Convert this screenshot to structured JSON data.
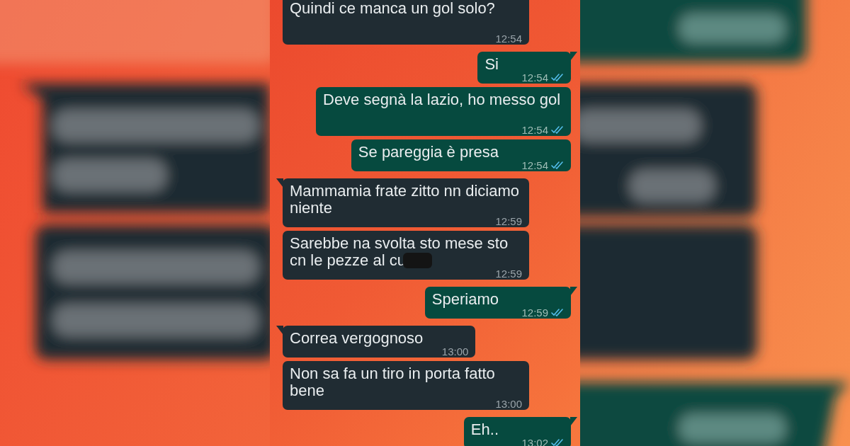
{
  "messages": [
    {
      "kind": "incoming",
      "text": "Quindi ce manca un gol solo?",
      "time": "12:54",
      "tail": false,
      "censored": false
    },
    {
      "kind": "outgoing",
      "text": "Si",
      "time": "12:54",
      "tail": true,
      "read": true
    },
    {
      "kind": "outgoing",
      "text": "Deve segnà la lazio, ho messo gol",
      "time": "12:54",
      "tail": false,
      "read": true
    },
    {
      "kind": "outgoing",
      "text": "Se pareggia è presa",
      "time": "12:54",
      "tail": false,
      "read": true
    },
    {
      "kind": "incoming",
      "text": "Mammamia frate zitto nn diciamo niente",
      "time": "12:59",
      "tail": true,
      "censored": false
    },
    {
      "kind": "incoming",
      "text": "Sarebbe na svolta sto mese sto cn le pezze al cu",
      "time": "12:59",
      "tail": false,
      "censored": true
    },
    {
      "kind": "outgoing",
      "text": "Speriamo",
      "time": "12:59",
      "tail": true,
      "read": true
    },
    {
      "kind": "incoming",
      "text": "Correa vergognoso",
      "time": "13:00",
      "tail": true,
      "censored": false
    },
    {
      "kind": "incoming",
      "text": "Non sa fa un tiro in porta fatto bene",
      "time": "13:00",
      "tail": false,
      "censored": false
    },
    {
      "kind": "outgoing",
      "text": "Eh..",
      "time": "13:02",
      "tail": true,
      "read": true
    }
  ]
}
